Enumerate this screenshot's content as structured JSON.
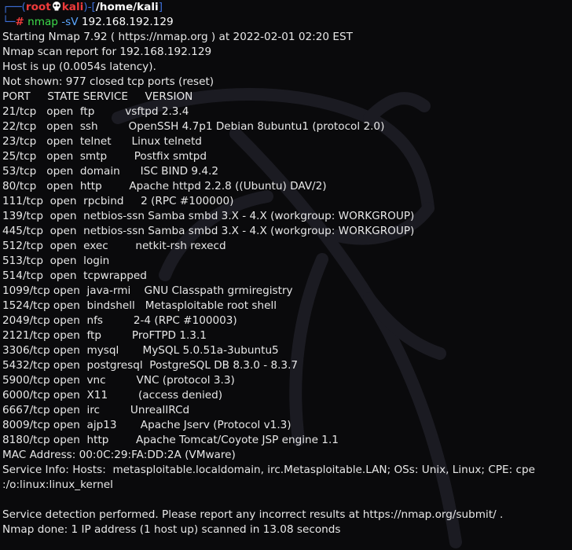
{
  "prompt": {
    "user": "root",
    "at_icon": "skull-icon",
    "host": "kali",
    "path": "/home/kali",
    "command": "nmap",
    "flag": "-sV",
    "target": "192.168.192.129"
  },
  "colors": {
    "background": "#0a0a0c",
    "text": "#e8e8e8",
    "prompt_frame": "#3d6fd8",
    "prompt_user": "#ef3b3b",
    "command": "#3ddc4a",
    "flag": "#5aa6ff"
  },
  "output": [
    "Starting Nmap 7.92 ( https://nmap.org ) at 2022-02-01 02:20 EST",
    "Nmap scan report for 192.168.192.129",
    "Host is up (0.0054s latency).",
    "Not shown: 977 closed tcp ports (reset)",
    "PORT     STATE SERVICE     VERSION",
    "21/tcp   open  ftp         vsftpd 2.3.4",
    "22/tcp   open  ssh         OpenSSH 4.7p1 Debian 8ubuntu1 (protocol 2.0)",
    "23/tcp   open  telnet      Linux telnetd",
    "25/tcp   open  smtp        Postfix smtpd",
    "53/tcp   open  domain      ISC BIND 9.4.2",
    "80/tcp   open  http        Apache httpd 2.2.8 ((Ubuntu) DAV/2)",
    "111/tcp  open  rpcbind     2 (RPC #100000)",
    "139/tcp  open  netbios-ssn Samba smbd 3.X - 4.X (workgroup: WORKGROUP)",
    "445/tcp  open  netbios-ssn Samba smbd 3.X - 4.X (workgroup: WORKGROUP)",
    "512/tcp  open  exec        netkit-rsh rexecd",
    "513/tcp  open  login",
    "514/tcp  open  tcpwrapped",
    "1099/tcp open  java-rmi    GNU Classpath grmiregistry",
    "1524/tcp open  bindshell   Metasploitable root shell",
    "2049/tcp open  nfs         2-4 (RPC #100003)",
    "2121/tcp open  ftp         ProFTPD 1.3.1",
    "3306/tcp open  mysql       MySQL 5.0.51a-3ubuntu5",
    "5432/tcp open  postgresql  PostgreSQL DB 8.3.0 - 8.3.7",
    "5900/tcp open  vnc         VNC (protocol 3.3)",
    "6000/tcp open  X11         (access denied)",
    "6667/tcp open  irc         UnrealIRCd",
    "8009/tcp open  ajp13       Apache Jserv (Protocol v1.3)",
    "8180/tcp open  http        Apache Tomcat/Coyote JSP engine 1.1",
    "MAC Address: 00:0C:29:FA:DD:2A (VMware)",
    "Service Info: Hosts:  metasploitable.localdomain, irc.Metasploitable.LAN; OSs: Unix, Linux; CPE: cpe",
    ":/o:linux:linux_kernel",
    "",
    "Service detection performed. Please report any incorrect results at https://nmap.org/submit/ .",
    "Nmap done: 1 IP address (1 host up) scanned in 13.08 seconds"
  ]
}
